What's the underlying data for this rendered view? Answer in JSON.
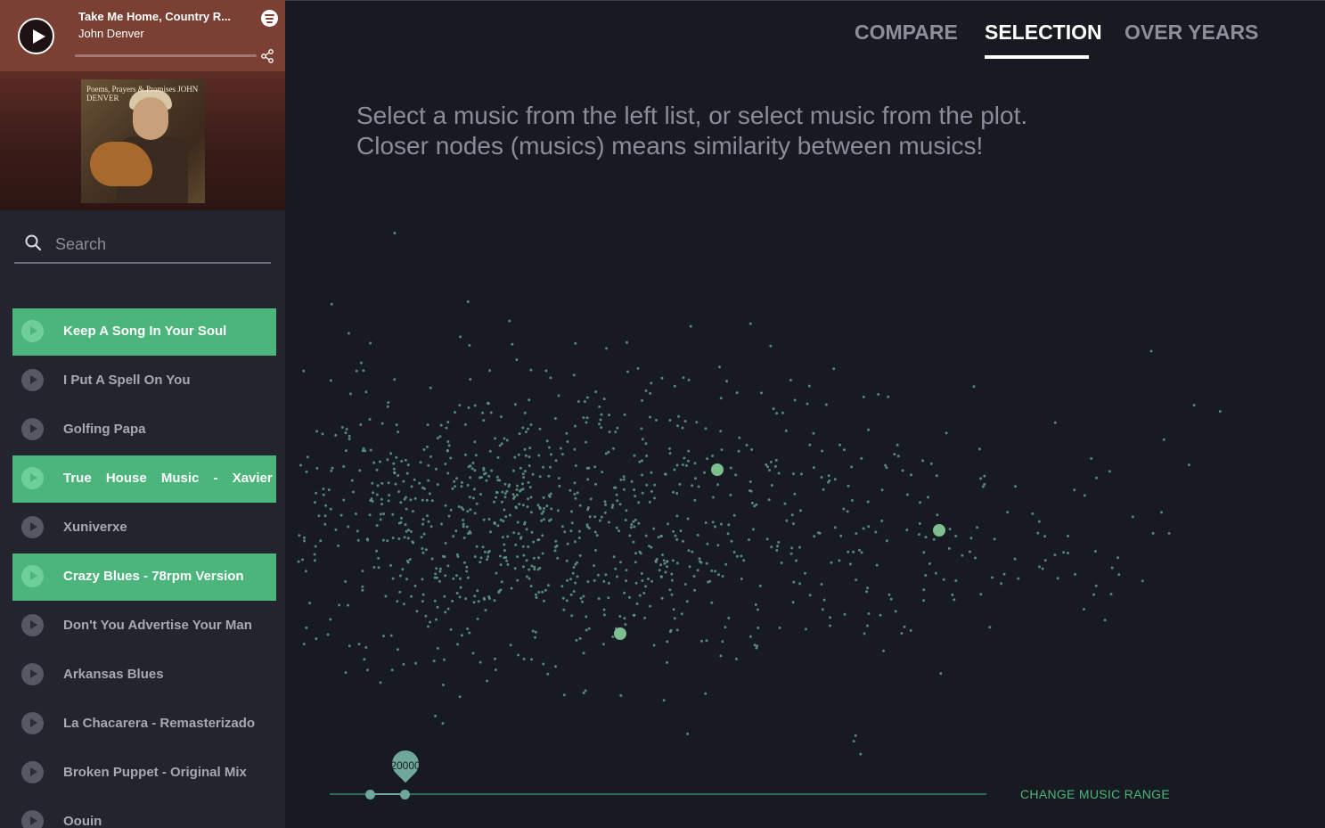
{
  "player": {
    "title": "Take Me Home, Country R...",
    "artist": "John Denver",
    "play_icon": "play-icon",
    "brand_icon": "spotify-icon",
    "share_icon": "share-icon",
    "album_text": "Poems, Prayers & Promises JOHN DENVER"
  },
  "search": {
    "placeholder": "Search",
    "value": ""
  },
  "songs": [
    {
      "label": "Keep A Song In Your Soul",
      "active": true
    },
    {
      "label": "I Put A Spell On You",
      "active": false
    },
    {
      "label": "Golfing Papa",
      "active": false
    },
    {
      "label": "True House Music - Xavier",
      "active": true
    },
    {
      "label": "Xuniverxe",
      "active": false
    },
    {
      "label": "Crazy Blues - 78rpm Version",
      "active": true
    },
    {
      "label": "Don't You Advertise Your Man",
      "active": false
    },
    {
      "label": "Arkansas Blues",
      "active": false
    },
    {
      "label": "La Chacarera - Remasterizado",
      "active": false
    },
    {
      "label": "Broken Puppet - Original Mix",
      "active": false
    },
    {
      "label": "Oouin",
      "active": false
    }
  ],
  "tabs": [
    {
      "label": "COMPARE",
      "active": false
    },
    {
      "label": "SELECTION",
      "active": true
    },
    {
      "label": "OVER YEARS",
      "active": false
    }
  ],
  "instruction": {
    "line1": "Select a music from the left list, or select music from the plot.",
    "line2": "Closer nodes (musics) means similarity between musics!"
  },
  "slider": {
    "value": "20000",
    "button_label": "CHANGE MUSIC RANGE"
  },
  "colors": {
    "accent": "#4cb57c",
    "node": "#5f9a8c",
    "highlight_node": "#7dbf8f",
    "background": "#181a21",
    "sidebar": "#22242e"
  }
}
